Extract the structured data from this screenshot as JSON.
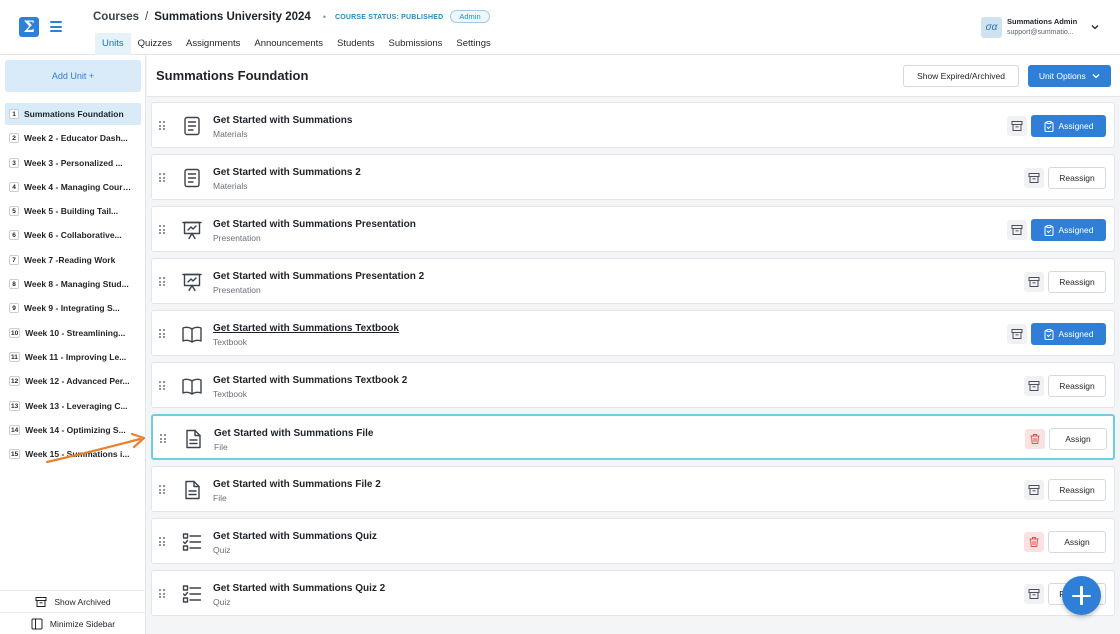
{
  "header": {
    "logo": "Σ",
    "breadcrumb_root": "Courses",
    "breadcrumb_sep": "/",
    "course_title": "Summations University 2024",
    "dot": "•",
    "course_status": "COURSE STATUS: PUBLISHED",
    "role_badge": "Admin",
    "tabs": [
      "Units",
      "Quizzes",
      "Assignments",
      "Announcements",
      "Students",
      "Submissions",
      "Settings"
    ],
    "active_tab": "Units",
    "user": {
      "avatar": "σα",
      "name": "Summations Admin",
      "email": "support@summatio..."
    }
  },
  "sidebar": {
    "add_unit_label": "Add Unit +",
    "units": [
      {
        "num": "1",
        "label": "Summations Foundation",
        "active": true
      },
      {
        "num": "2",
        "label": "Week 2 - Educator Dash..."
      },
      {
        "num": "3",
        "label": "Week 3 - Personalized ..."
      },
      {
        "num": "4",
        "label": "Week 4 - Managing Cours..."
      },
      {
        "num": "5",
        "label": "Week 5 - Building Tail..."
      },
      {
        "num": "6",
        "label": "Week 6 - Collaborative..."
      },
      {
        "num": "7",
        "label": "Week 7 -Reading Work"
      },
      {
        "num": "8",
        "label": "Week 8 - Managing Stud..."
      },
      {
        "num": "9",
        "label": "Week 9 - Integrating S..."
      },
      {
        "num": "10",
        "label": "Week 10 - Streamlining..."
      },
      {
        "num": "11",
        "label": "Week 11 - Improving Le..."
      },
      {
        "num": "12",
        "label": "Week 12 - Advanced Per..."
      },
      {
        "num": "13",
        "label": "Week 13 - Leveraging C..."
      },
      {
        "num": "14",
        "label": "Week 14 - Optimizing S..."
      },
      {
        "num": "15",
        "label": "Week 15 - Summations i..."
      }
    ],
    "show_archived_label": "Show Archived",
    "minimize_label": "Minimize Sidebar"
  },
  "main": {
    "title": "Summations Foundation",
    "show_expired_label": "Show Expired/Archived",
    "unit_options_label": "Unit Options",
    "items": [
      {
        "title": "Get Started with Summations",
        "type": "Materials",
        "icon": "document-icon",
        "action": "Assigned"
      },
      {
        "title": "Get Started with Summations 2",
        "type": "Materials",
        "icon": "document-icon",
        "action": "Reassign"
      },
      {
        "title": "Get Started with Summations Presentation",
        "type": "Presentation",
        "icon": "presentation-icon",
        "action": "Assigned"
      },
      {
        "title": "Get Started with Summations Presentation 2",
        "type": "Presentation",
        "icon": "presentation-icon",
        "action": "Reassign"
      },
      {
        "title": "Get Started with Summations Textbook",
        "type": "Textbook",
        "icon": "book-icon",
        "action": "Assigned"
      },
      {
        "title": "Get Started with Summations Textbook 2",
        "type": "Textbook",
        "icon": "book-icon",
        "action": "Reassign"
      },
      {
        "title": "Get Started with Summations File",
        "type": "File",
        "icon": "file-icon",
        "action": "Assign"
      },
      {
        "title": "Get Started with Summations File 2",
        "type": "File",
        "icon": "file-icon",
        "action": "Reassign"
      },
      {
        "title": "Get Started with Summations Quiz",
        "type": "Quiz",
        "icon": "quiz-icon",
        "action": "Assign"
      },
      {
        "title": "Get Started with Summations Quiz 2",
        "type": "Quiz",
        "icon": "quiz-icon",
        "action": "Reassign"
      }
    ],
    "fab_icon": "plus-icon"
  },
  "colors": {
    "accent": "#2f7fd6",
    "selected_border": "#6dcde3",
    "annotation_arrow": "#e8812c",
    "trash_bg": "#fbe2e2"
  }
}
